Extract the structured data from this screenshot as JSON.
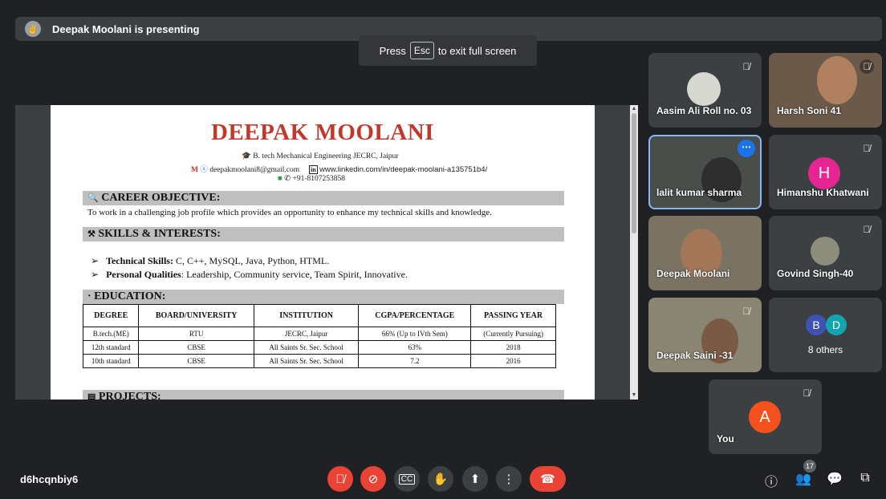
{
  "presenting": {
    "avatar": "✌",
    "text": "Deepak Moolani is presenting"
  },
  "fullscreen_toast": {
    "prefix": "Press",
    "key": "Esc",
    "suffix": "to exit full screen"
  },
  "document": {
    "name": "DEEPAK MOOLANI",
    "degree_line": "B. tech Mechanical Engineering JECRC, Jaipur",
    "email": "deepakmoolani8@gmail.com",
    "linkedin": "www.linkedin.com/in/deepak-moolani-a135751b4/",
    "phone": "+91-8107253858",
    "career_heading": "CAREER OBJECTIVE:",
    "career_text": "To work in a challenging job profile which provides an opportunity to enhance my technical skills and knowledge.",
    "skills_heading": "SKILLS & INTERESTS:",
    "tech_label": "Technical Skills:",
    "tech_value": " C, C++, MySQL, Java, Python, HTML.",
    "personal_label": "Personal Qualities",
    "personal_value": ": Leadership, Community service, Team Spirit, Innovative.",
    "education_heading": "EDUCATION:",
    "education_columns": [
      "DEGREE",
      "BOARD/UNIVERSITY",
      "INSTITUTION",
      "CGPA/PERCENTAGE",
      "PASSING YEAR"
    ],
    "education_rows": [
      [
        "B.tech.(ME)",
        "RTU",
        "JECRC, Jaipur",
        "66% (Up to IVth Sem)",
        "(Currently Pursuing)"
      ],
      [
        "12th standard",
        "CBSE",
        "All Saints Sr. Sec. School",
        "63%",
        "2018"
      ],
      [
        "10th standard",
        "CBSE",
        "All Saints Sr. Sec. School",
        "7.2",
        "2016"
      ]
    ],
    "projects_heading": "PROJECTS:"
  },
  "participants": [
    {
      "name": "Aasim Ali Roll no. 03"
    },
    {
      "name": "Harsh Soni 41"
    },
    {
      "name": "lalit kumar sharma"
    },
    {
      "name": "Himanshu Khatwani",
      "initial": "H"
    },
    {
      "name": "Deepak Moolani"
    },
    {
      "name": "Govind Singh-40"
    },
    {
      "name": "Deepak Saini -31"
    },
    {
      "name": "8 others",
      "initials": [
        "B",
        "D"
      ]
    }
  ],
  "self_tile": {
    "name": "You",
    "initial": "A"
  },
  "meeting_code": "d6hcqnbiy6",
  "people_count": "17",
  "colors": {
    "accent": "#8ab4f8",
    "red": "#ea4335",
    "tile": "#3c4043",
    "background": "#202124"
  }
}
